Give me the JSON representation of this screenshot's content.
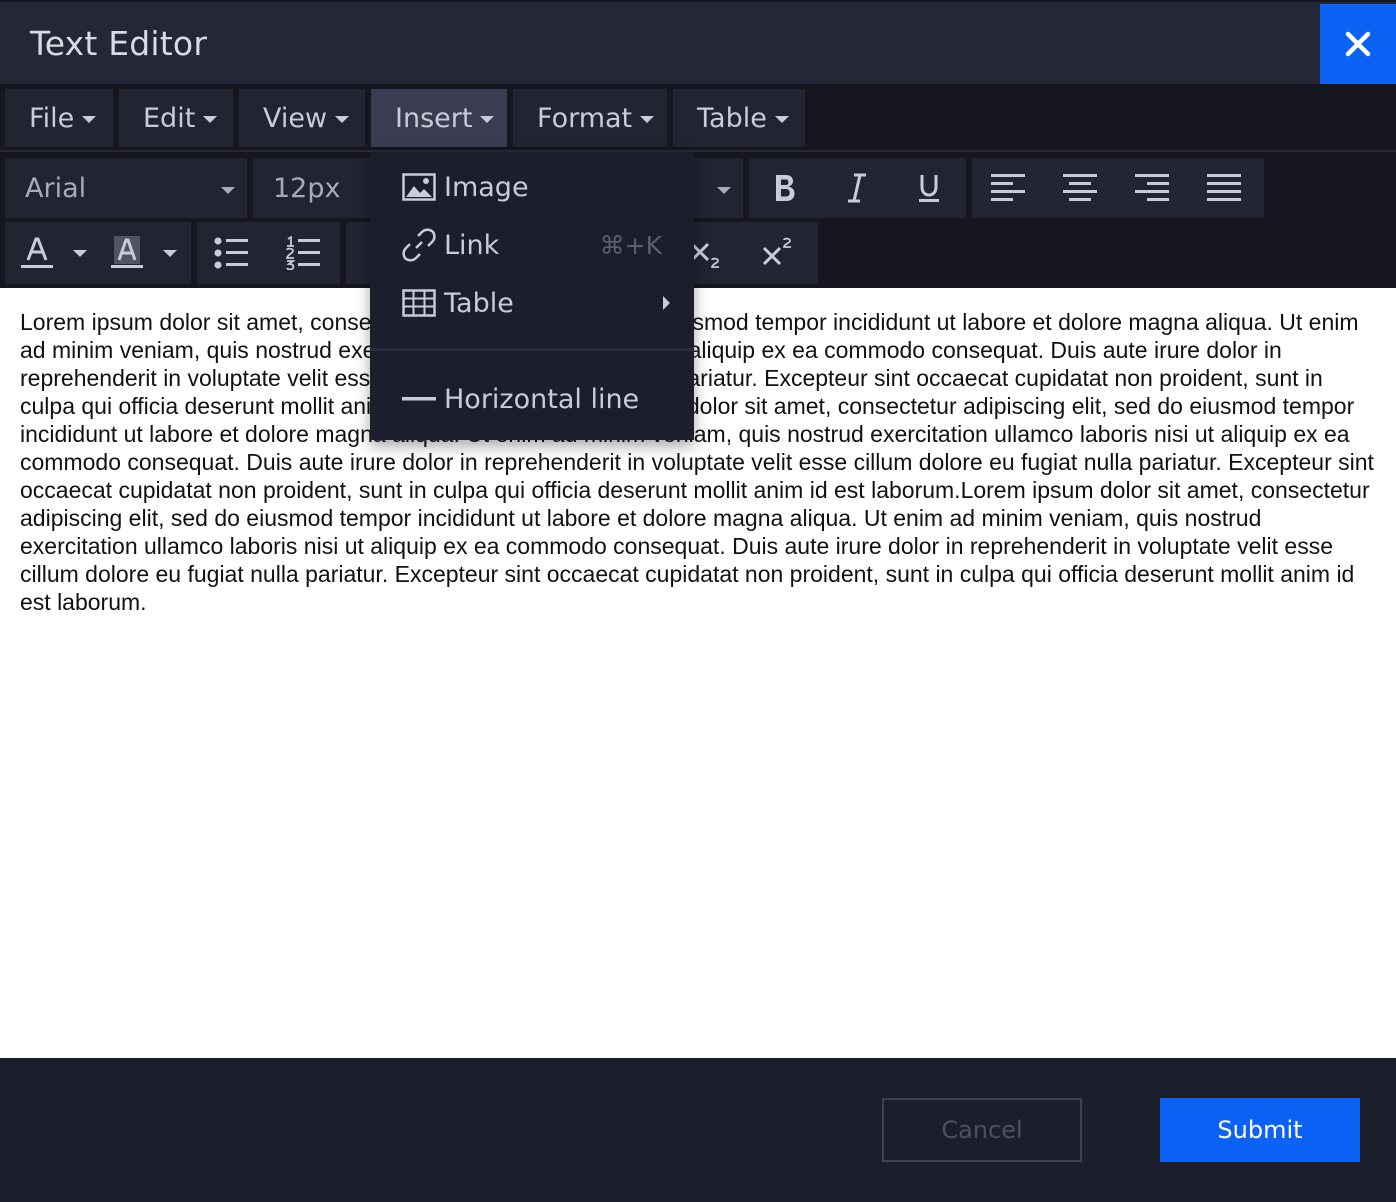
{
  "window": {
    "title": "Text Editor",
    "close_icon": "close-icon"
  },
  "menubar": {
    "items": [
      {
        "label": "File"
      },
      {
        "label": "Edit"
      },
      {
        "label": "View"
      },
      {
        "label": "Insert",
        "active": true
      },
      {
        "label": "Format"
      },
      {
        "label": "Table"
      }
    ]
  },
  "toolbar": {
    "font_family": "Arial",
    "font_size": "12px"
  },
  "insert_menu": {
    "image": {
      "label": "Image",
      "icon": "image-icon"
    },
    "link": {
      "label": "Link",
      "shortcut": "⌘+K",
      "icon": "link-icon"
    },
    "table": {
      "label": "Table",
      "icon": "table-grid-icon"
    },
    "horizontal_line": {
      "label": "Horizontal line",
      "icon": "horizontal-line-icon"
    }
  },
  "editor": {
    "text": "Lorem ipsum dolor sit amet, consectetur adipiscing elit, sed do eiusmod tempor incididunt ut labore et dolore magna aliqua. Ut enim ad minim veniam, quis nostrud exercitation ullamco laboris nisi ut aliquip ex ea commodo consequat. Duis aute irure dolor in reprehenderit in voluptate velit esse cillum dolore eu fugiat nulla pariatur. Excepteur sint occaecat cupidatat non proident, sunt in culpa qui officia deserunt mollit anim id est laborum.Lorem ipsum dolor sit amet, consectetur adipiscing elit, sed do eiusmod tempor incididunt ut labore et dolore magna aliqua. Ut enim ad minim veniam, quis nostrud exercitation ullamco laboris nisi ut aliquip ex ea commodo consequat. Duis aute irure dolor in reprehenderit in voluptate velit esse cillum dolore eu fugiat nulla pariatur. Excepteur sint occaecat cupidatat non proident, sunt in culpa qui officia deserunt mollit anim id est laborum.Lorem ipsum dolor sit amet, consectetur adipiscing elit, sed do eiusmod tempor incididunt ut labore et dolore magna aliqua. Ut enim ad minim veniam, quis nostrud exercitation ullamco laboris nisi ut aliquip ex ea commodo consequat. Duis aute irure dolor in reprehenderit in voluptate velit esse cillum dolore eu fugiat nulla pariatur. Excepteur sint occaecat cupidatat non proident, sunt in culpa qui officia deserunt mollit anim id est laborum."
  },
  "footer": {
    "cancel_label": "Cancel",
    "submit_label": "Submit"
  },
  "colors": {
    "accent": "#0b62f5",
    "background": "#1c1e2b",
    "panel": "#222432",
    "active_menu": "#3a3c51"
  }
}
